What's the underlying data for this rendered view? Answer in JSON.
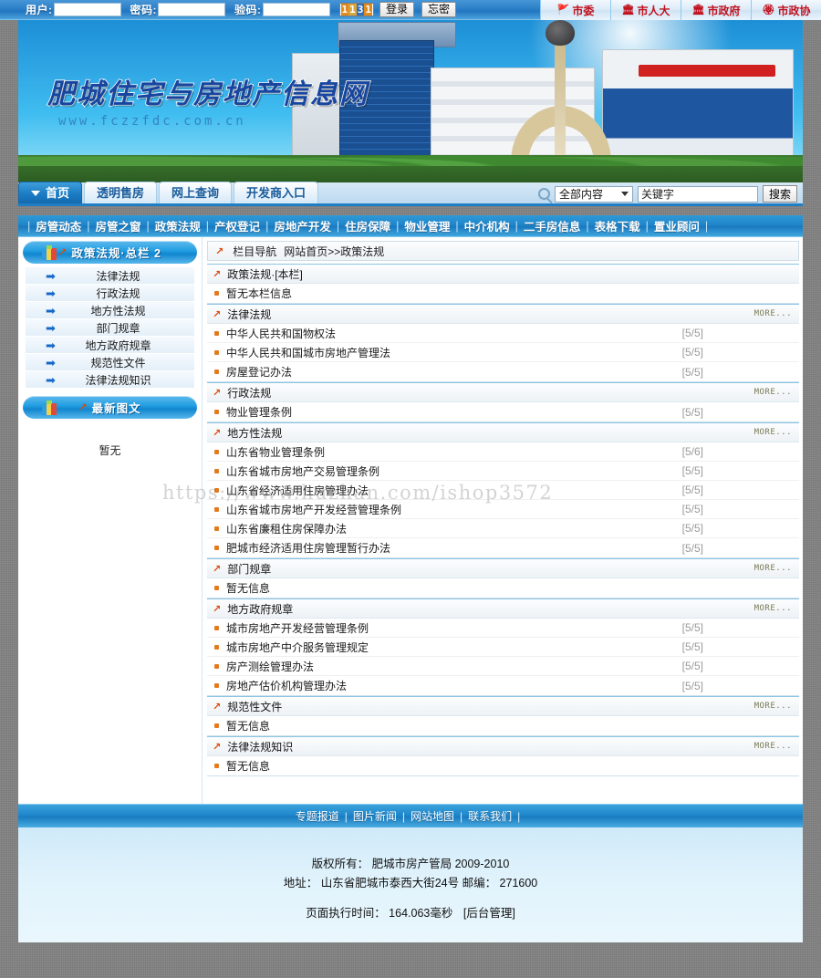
{
  "login": {
    "user_label": "用户:",
    "user_value": "",
    "pass_label": "密码:",
    "pass_value": "",
    "captcha_label": "验码:",
    "captcha_value": "",
    "captcha_digits": [
      "1",
      "1",
      "3",
      "1"
    ],
    "login_button": "登录",
    "forgot_button": "忘密"
  },
  "gov_links": [
    {
      "label": "市委",
      "icon": "party-emblem-icon"
    },
    {
      "label": "市人大",
      "icon": "national-emblem-icon"
    },
    {
      "label": "市政府",
      "icon": "national-emblem-icon"
    },
    {
      "label": "市政协",
      "icon": "cppcc-emblem-icon"
    }
  ],
  "banner": {
    "title": "肥城住宅与房地产信息网",
    "url": "www.fczzfdc.com.cn"
  },
  "tabs": [
    {
      "label": "首页",
      "active": true
    },
    {
      "label": "透明售房",
      "active": false
    },
    {
      "label": "网上查询",
      "active": false
    },
    {
      "label": "开发商入口",
      "active": false
    }
  ],
  "search": {
    "scope_selected": "全部内容",
    "keyword_value": "关键字",
    "keyword_placeholder": "关键字",
    "button": "搜索"
  },
  "channels": [
    "房管动态",
    "房管之窗",
    "政策法规",
    "产权登记",
    "房地产开发",
    "住房保障",
    "物业管理",
    "中介机构",
    "二手房信息",
    "表格下载",
    "置业顾问"
  ],
  "sidebar": {
    "panel_title": "政策法规·总栏 2",
    "items": [
      "法律法规",
      "行政法规",
      "地方性法规",
      "部门规章",
      "地方政府规章",
      "规范性文件",
      "法律法规知识"
    ],
    "photo_panel_title": "最新图文",
    "photo_panel_empty": "暂无"
  },
  "breadcrumb": {
    "label": "栏目导航",
    "path": "网站首页>>政策法规"
  },
  "more_label": "MORE...",
  "sections": [
    {
      "title": "政策法规·[本栏]",
      "show_more": false,
      "rows": [
        {
          "title": "暂无本栏信息",
          "date": "",
          "empty": true
        }
      ]
    },
    {
      "title": "法律法规",
      "show_more": true,
      "rows": [
        {
          "title": "中华人民共和国物权法",
          "date": "[5/5]",
          "empty": false
        },
        {
          "title": "中华人民共和国城市房地产管理法",
          "date": "[5/5]",
          "empty": false
        },
        {
          "title": "房屋登记办法",
          "date": "[5/5]",
          "empty": false
        }
      ]
    },
    {
      "title": "行政法规",
      "show_more": true,
      "rows": [
        {
          "title": "物业管理条例",
          "date": "[5/5]",
          "empty": false
        }
      ]
    },
    {
      "title": "地方性法规",
      "show_more": true,
      "rows": [
        {
          "title": "山东省物业管理条例",
          "date": "[5/6]",
          "empty": false
        },
        {
          "title": "山东省城市房地产交易管理条例",
          "date": "[5/5]",
          "empty": false
        },
        {
          "title": "山东省经济适用住房管理办法",
          "date": "[5/5]",
          "empty": false
        },
        {
          "title": "山东省城市房地产开发经营管理条例",
          "date": "[5/5]",
          "empty": false
        },
        {
          "title": "山东省廉租住房保障办法",
          "date": "[5/5]",
          "empty": false
        },
        {
          "title": "肥城市经济适用住房管理暂行办法",
          "date": "[5/5]",
          "empty": false
        }
      ]
    },
    {
      "title": "部门规章",
      "show_more": true,
      "rows": [
        {
          "title": "暂无信息",
          "date": "",
          "empty": true
        }
      ]
    },
    {
      "title": "地方政府规章",
      "show_more": true,
      "rows": [
        {
          "title": "城市房地产开发经营管理条例",
          "date": "[5/5]",
          "empty": false
        },
        {
          "title": "城市房地产中介服务管理规定",
          "date": "[5/5]",
          "empty": false
        },
        {
          "title": "房产测绘管理办法",
          "date": "[5/5]",
          "empty": false
        },
        {
          "title": "房地产估价机构管理办法",
          "date": "[5/5]",
          "empty": false
        }
      ]
    },
    {
      "title": "规范性文件",
      "show_more": true,
      "rows": [
        {
          "title": "暂无信息",
          "date": "",
          "empty": true
        }
      ]
    },
    {
      "title": "法律法规知识",
      "show_more": true,
      "rows": [
        {
          "title": "暂无信息",
          "date": "",
          "empty": true
        }
      ]
    }
  ],
  "watermark": "https://www.huzhan.com/ishop3572",
  "footer_nav": [
    "专题报道",
    "图片新闻",
    "网站地图",
    "联系我们"
  ],
  "footer": {
    "copyright": "版权所有： 肥城市房产管局  2009-2010",
    "address": "地址： 山东省肥城市泰西大街24号 邮编： 271600",
    "exec_time": "页面执行时间： 164.063毫秒",
    "admin": "[后台管理]"
  },
  "colors": {
    "brand_blue": "#1f84c9",
    "accent_orange": "#d94b0c",
    "bullet_orange": "#e37b1e",
    "title_blue": "#1746a0"
  }
}
